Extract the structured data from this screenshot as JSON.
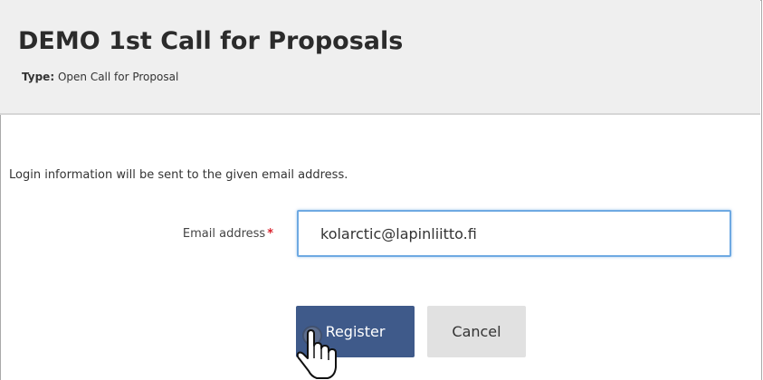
{
  "header": {
    "title": "DEMO 1st Call for Proposals",
    "type_label": "Type:",
    "type_value": "Open Call for Proposal"
  },
  "form": {
    "info_text": "Login information will be sent to the given email address.",
    "email_label": "Email address",
    "required_marker": "*",
    "email_value": "kolarctic@lapinliitto.fi"
  },
  "buttons": {
    "register_label": "Register",
    "cancel_label": "Cancel"
  },
  "colors": {
    "header_bg": "#efefef",
    "primary_button": "#3f5a8a",
    "secondary_button": "#e1e1e1",
    "focus_border": "#6ea9e2",
    "required": "#d9232d"
  },
  "icons": {
    "cursor": "hand-pointer-icon"
  }
}
